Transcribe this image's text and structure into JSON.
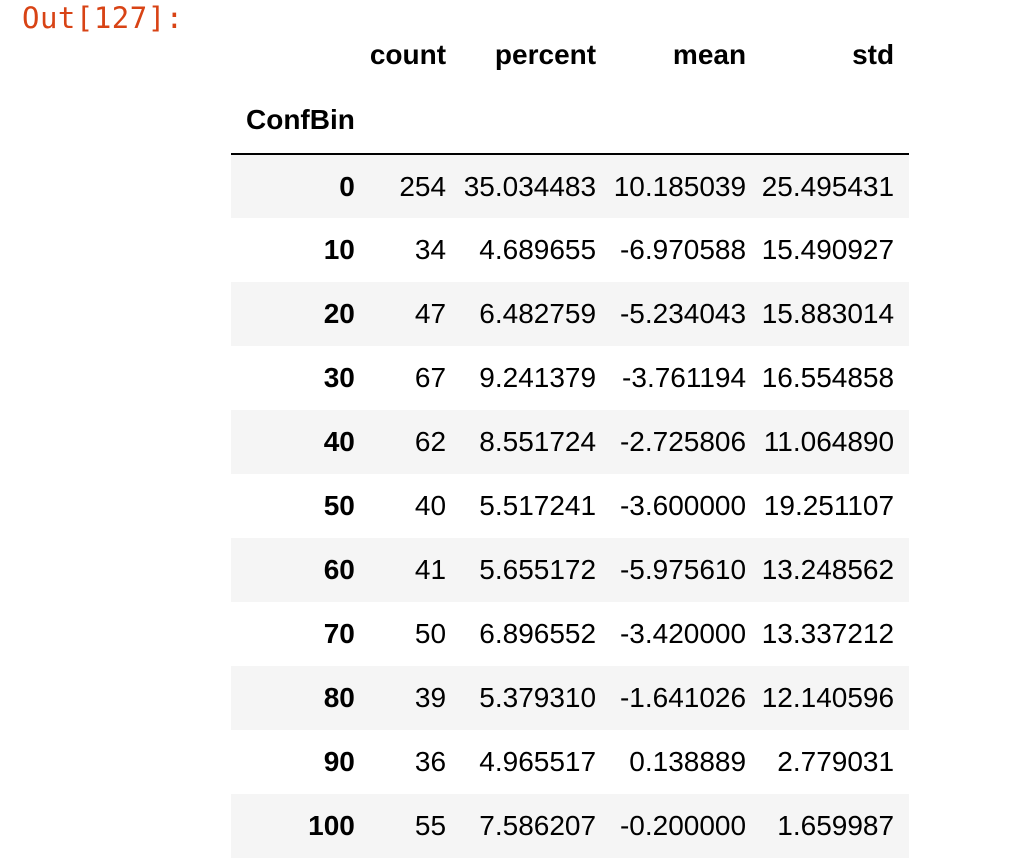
{
  "output": {
    "prompt": "Out[127]:"
  },
  "table": {
    "index_name": "ConfBin",
    "columns": [
      "count",
      "percent",
      "mean",
      "std"
    ],
    "rows": [
      {
        "index": "0",
        "count": "254",
        "percent": "35.034483",
        "mean": "10.185039",
        "std": "25.495431"
      },
      {
        "index": "10",
        "count": "34",
        "percent": "4.689655",
        "mean": "-6.970588",
        "std": "15.490927"
      },
      {
        "index": "20",
        "count": "47",
        "percent": "6.482759",
        "mean": "-5.234043",
        "std": "15.883014"
      },
      {
        "index": "30",
        "count": "67",
        "percent": "9.241379",
        "mean": "-3.761194",
        "std": "16.554858"
      },
      {
        "index": "40",
        "count": "62",
        "percent": "8.551724",
        "mean": "-2.725806",
        "std": "11.064890"
      },
      {
        "index": "50",
        "count": "40",
        "percent": "5.517241",
        "mean": "-3.600000",
        "std": "19.251107"
      },
      {
        "index": "60",
        "count": "41",
        "percent": "5.655172",
        "mean": "-5.975610",
        "std": "13.248562"
      },
      {
        "index": "70",
        "count": "50",
        "percent": "6.896552",
        "mean": "-3.420000",
        "std": "13.337212"
      },
      {
        "index": "80",
        "count": "39",
        "percent": "5.379310",
        "mean": "-1.641026",
        "std": "12.140596"
      },
      {
        "index": "90",
        "count": "36",
        "percent": "4.965517",
        "mean": "0.138889",
        "std": "2.779031"
      },
      {
        "index": "100",
        "count": "55",
        "percent": "7.586207",
        "mean": "-0.200000",
        "std": "1.659987"
      }
    ]
  }
}
